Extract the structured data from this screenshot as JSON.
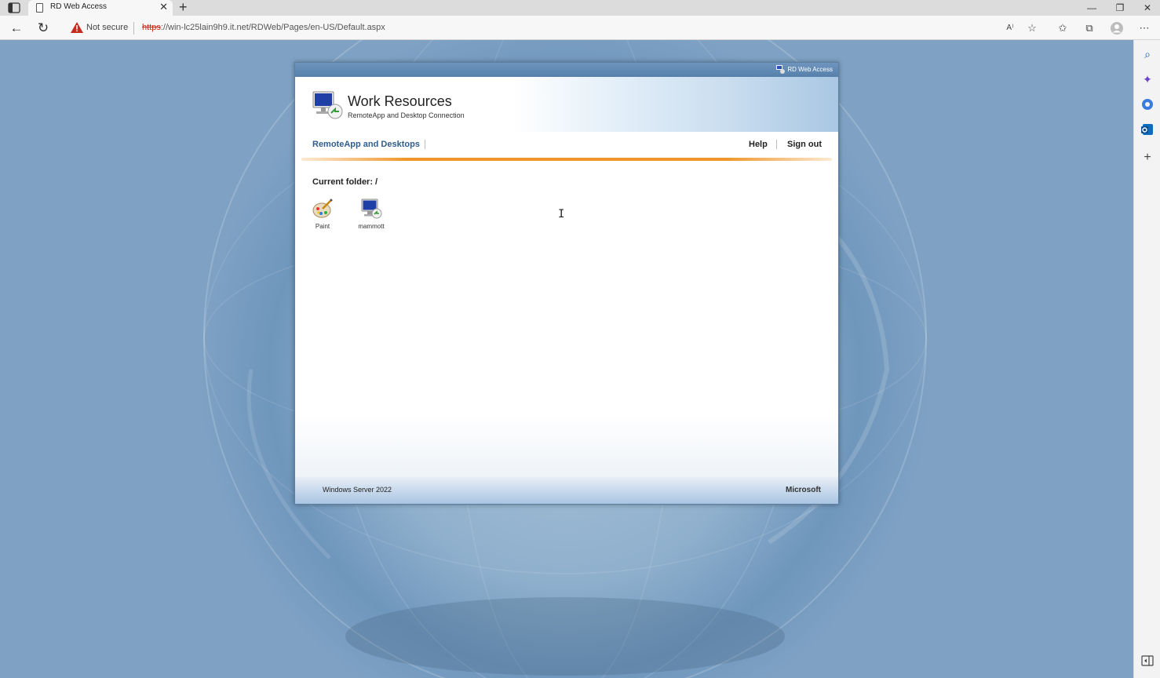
{
  "browser": {
    "tab_title": "RD Web Access",
    "tab_close": "✕",
    "new_tab": "+",
    "security_label": "Not secure",
    "url_scheme": "https",
    "url_rest": "://win-lc25lain9h9.it.net/RDWeb/Pages/en-US/Default.aspx",
    "window_minimize": "—",
    "window_restore": "❐",
    "window_close": "✕"
  },
  "rd": {
    "topstrip_label": "RD Web Access",
    "title": "Work Resources",
    "subtitle": "RemoteApp and Desktop Connection",
    "nav": {
      "remoteapp": "RemoteApp and Desktops",
      "help": "Help",
      "signout": "Sign out"
    },
    "current_folder": "Current folder: /",
    "apps": [
      {
        "name": "Paint",
        "icon": "paint-icon"
      },
      {
        "name": "mammott",
        "icon": "remote-desktop-icon"
      }
    ],
    "footer_os": "Windows Server 2022",
    "footer_brand": "Microsoft"
  },
  "colors": {
    "nav_link": "#2f5d8c",
    "accent_orange": "#f0962a",
    "warning_red": "#c42b1c"
  }
}
